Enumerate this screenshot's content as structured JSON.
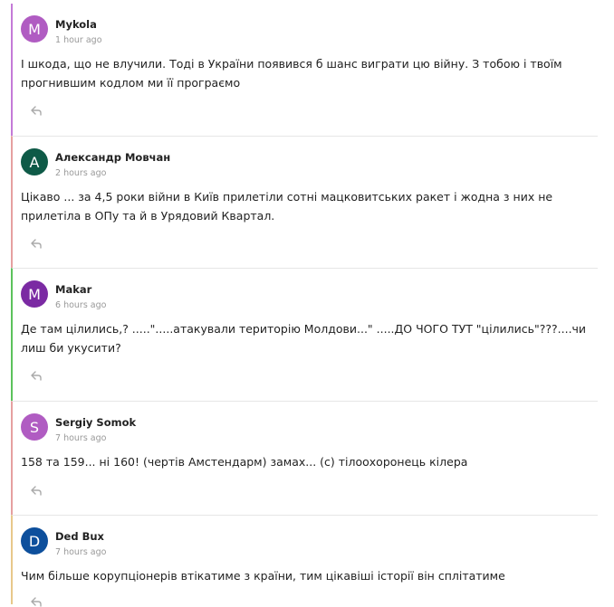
{
  "comments": [
    {
      "author": "Mykola",
      "avatar_letter": "M",
      "avatar_color": "#b05cc2",
      "border_color": "#c47ad8",
      "time": "1 hour ago",
      "text": "І шкода, що не влучили. Тоді в України появився б шанс виграти цю війну. З тобою і твоїм прогнившим кодлом ми її програємо",
      "reply_icon": "reply-arrow-icon"
    },
    {
      "author": "Александр Мовчан",
      "avatar_letter": "A",
      "avatar_color": "#0e5a47",
      "border_color": "#e6a0a0",
      "time": "2 hours ago",
      "text": "Цікаво ... за 4,5 роки війни в Київ прилетіли сотні мацковитських ракет і жодна з них не прилетіла в ОПу та й в Урядовий Квартал.",
      "reply_icon": "reply-arrow-icon"
    },
    {
      "author": "Makar",
      "avatar_letter": "M",
      "avatar_color": "#7b2aa3",
      "border_color": "#5cc25c",
      "time": "6 hours ago",
      "text": "Де там цілились,? .....\".....атакували територію Молдови...\" .....ДО ЧОГО ТУТ \"цілились\"???....чи лиш би укусити?",
      "reply_icon": "reply-arrow-icon"
    },
    {
      "author": "Sergiy Somok",
      "avatar_letter": "S",
      "avatar_color": "#b05cc2",
      "border_color": "#e6a0a0",
      "time": "7 hours ago",
      "text": "158 та 159... ні 160! (чертів Амстендарм) замах... (с) тілоохоронець кілера",
      "reply_icon": "reply-arrow-icon"
    },
    {
      "author": "Ded Bux",
      "avatar_letter": "D",
      "avatar_color": "#0d4f9c",
      "border_color": "#e8c88a",
      "time": "7 hours ago",
      "text": "Чим більше корупціонерів втікатиме з країни, тим цікавіші історії він сплітатиме",
      "reply_icon": "reply-arrow-icon"
    }
  ]
}
